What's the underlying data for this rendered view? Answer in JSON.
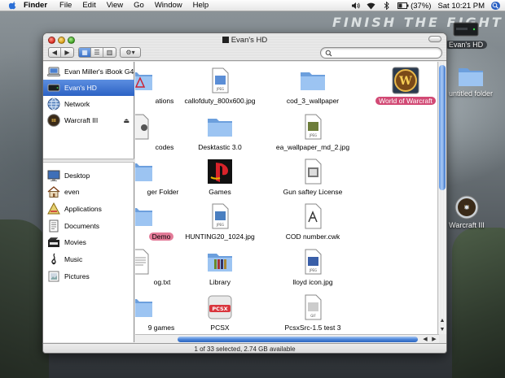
{
  "menubar": {
    "app_name": "Finder",
    "items": [
      "File",
      "Edit",
      "View",
      "Go",
      "Window",
      "Help"
    ],
    "battery": "(37%)",
    "clock": "Sat 10:21 PM"
  },
  "wallpaper": {
    "title": "FINISH THE FIGHT"
  },
  "desktop": {
    "icons": [
      {
        "label": "Evan's HD",
        "icon": "hard-drive-icon"
      },
      {
        "label": "untitled folder",
        "icon": "folder-icon"
      },
      {
        "label": "Warcraft III",
        "icon": "cd-disc-icon"
      }
    ]
  },
  "window": {
    "title": "Evan's HD",
    "search_placeholder": "",
    "status": "1 of 33 selected, 2.74 GB available"
  },
  "sidebar": {
    "devices": [
      {
        "label": "Evan Miller's iBook G4",
        "icon": "laptop-icon",
        "selected": false
      },
      {
        "label": "Evan's HD",
        "icon": "hard-drive-icon",
        "selected": true
      },
      {
        "label": "Network",
        "icon": "network-icon",
        "selected": false
      },
      {
        "label": "Warcraft III",
        "icon": "cd-disc-icon",
        "selected": false,
        "eject": "⏏"
      }
    ],
    "places": [
      {
        "label": "Desktop",
        "icon": "desktop-icon"
      },
      {
        "label": "even",
        "icon": "home-icon"
      },
      {
        "label": "Applications",
        "icon": "applications-icon"
      },
      {
        "label": "Documents",
        "icon": "documents-icon"
      },
      {
        "label": "Movies",
        "icon": "movies-icon"
      },
      {
        "label": "Music",
        "icon": "music-icon"
      },
      {
        "label": "Pictures",
        "icon": "pictures-icon"
      }
    ]
  },
  "files": [
    {
      "label": "ations",
      "icon": "applications-folder-icon"
    },
    {
      "label": "callofduty_800x600.jpg",
      "icon": "jpeg-file-icon",
      "badge": "JPEG"
    },
    {
      "label": "cod_3_wallpaper",
      "icon": "folder-icon"
    },
    {
      "label": "World of Warcraft",
      "icon": "wow-app-icon",
      "selected": true
    },
    {
      "label": "codes",
      "icon": "file-icon"
    },
    {
      "label": "Desktastic 3.0",
      "icon": "folder-icon"
    },
    {
      "label": "ea_wallpaper_md_2.jpg",
      "icon": "jpeg-file-icon",
      "badge": "JPEG"
    },
    {
      "label": "ger Folder",
      "icon": "folder-icon"
    },
    {
      "label": "Games",
      "icon": "playstation-icon"
    },
    {
      "label": "Gun saftey License",
      "icon": "document-icon"
    },
    {
      "label": "Demo",
      "icon": "folder-icon",
      "pink": true
    },
    {
      "label": "HUNTING20_1024.jpg",
      "icon": "jpeg-file-icon",
      "badge": "JPEG"
    },
    {
      "label": "COD number.cwk",
      "icon": "appleworks-file-icon"
    },
    {
      "label": "og.txt",
      "icon": "text-file-icon"
    },
    {
      "label": "Library",
      "icon": "library-folder-icon"
    },
    {
      "label": "lloyd icon.jpg",
      "icon": "jpeg-file-icon",
      "badge": "JPEG"
    },
    {
      "label": "9 games",
      "icon": "folder-icon"
    },
    {
      "label": "PCSX",
      "icon": "pcsx-app-icon",
      "badge": "PCSX"
    },
    {
      "label": "PcsxSrc-1.5 test 3",
      "icon": "gif-file-icon",
      "badge": "GIF"
    }
  ],
  "colors": {
    "selection_blue": "#2c62c4",
    "selected_label": "#d24a75",
    "folder_blue": "#7fb0e8"
  }
}
